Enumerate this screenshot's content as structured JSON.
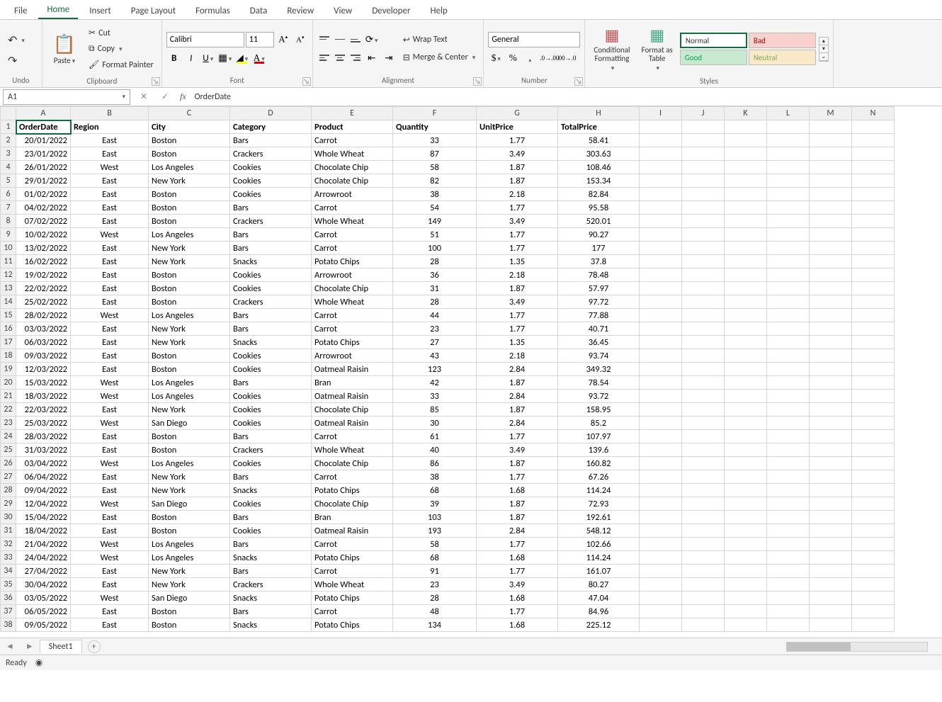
{
  "tabs": [
    "File",
    "Home",
    "Insert",
    "Page Layout",
    "Formulas",
    "Data",
    "Review",
    "View",
    "Developer",
    "Help"
  ],
  "active_tab": "Home",
  "ribbon": {
    "undo_label": "Undo",
    "clipboard_label": "Clipboard",
    "paste": "Paste",
    "cut": "Cut",
    "copy": "Copy",
    "format_painter": "Format Painter",
    "font_label": "Font",
    "font_name": "Calibri",
    "font_size": "11",
    "alignment_label": "Alignment",
    "wrap_text": "Wrap Text",
    "merge_center": "Merge & Center",
    "number_label": "Number",
    "number_format": "General",
    "cond_fmt": "Conditional\nFormatting",
    "fmt_table": "Format as\nTable",
    "styles_label": "Styles",
    "style_normal": "Normal",
    "style_bad": "Bad",
    "style_good": "Good",
    "style_neutral": "Neutral"
  },
  "namebox": "A1",
  "formula": "OrderDate",
  "columns": [
    "A",
    "B",
    "C",
    "D",
    "E",
    "F",
    "G",
    "H",
    "I",
    "J",
    "K",
    "L",
    "M",
    "N"
  ],
  "col_widths": [
    "col-A",
    "col-B",
    "col-C",
    "col-C",
    "col-C",
    "col-F",
    "col-G",
    "col-H",
    "col-rest",
    "col-rest",
    "col-rest",
    "col-rest",
    "col-rest",
    "col-rest"
  ],
  "headers": [
    "OrderDate",
    "Region",
    "City",
    "Category",
    "Product",
    "Quantity",
    "UnitPrice",
    "TotalPrice"
  ],
  "rows": [
    [
      "20/01/2022",
      "East",
      "Boston",
      "Bars",
      "Carrot",
      "33",
      "1.77",
      "58.41"
    ],
    [
      "23/01/2022",
      "East",
      "Boston",
      "Crackers",
      "Whole Wheat",
      "87",
      "3.49",
      "303.63"
    ],
    [
      "26/01/2022",
      "West",
      "Los Angeles",
      "Cookies",
      "Chocolate Chip",
      "58",
      "1.87",
      "108.46"
    ],
    [
      "29/01/2022",
      "East",
      "New York",
      "Cookies",
      "Chocolate Chip",
      "82",
      "1.87",
      "153.34"
    ],
    [
      "01/02/2022",
      "East",
      "Boston",
      "Cookies",
      "Arrowroot",
      "38",
      "2.18",
      "82.84"
    ],
    [
      "04/02/2022",
      "East",
      "Boston",
      "Bars",
      "Carrot",
      "54",
      "1.77",
      "95.58"
    ],
    [
      "07/02/2022",
      "East",
      "Boston",
      "Crackers",
      "Whole Wheat",
      "149",
      "3.49",
      "520.01"
    ],
    [
      "10/02/2022",
      "West",
      "Los Angeles",
      "Bars",
      "Carrot",
      "51",
      "1.77",
      "90.27"
    ],
    [
      "13/02/2022",
      "East",
      "New York",
      "Bars",
      "Carrot",
      "100",
      "1.77",
      "177"
    ],
    [
      "16/02/2022",
      "East",
      "New York",
      "Snacks",
      "Potato Chips",
      "28",
      "1.35",
      "37.8"
    ],
    [
      "19/02/2022",
      "East",
      "Boston",
      "Cookies",
      "Arrowroot",
      "36",
      "2.18",
      "78.48"
    ],
    [
      "22/02/2022",
      "East",
      "Boston",
      "Cookies",
      "Chocolate Chip",
      "31",
      "1.87",
      "57.97"
    ],
    [
      "25/02/2022",
      "East",
      "Boston",
      "Crackers",
      "Whole Wheat",
      "28",
      "3.49",
      "97.72"
    ],
    [
      "28/02/2022",
      "West",
      "Los Angeles",
      "Bars",
      "Carrot",
      "44",
      "1.77",
      "77.88"
    ],
    [
      "03/03/2022",
      "East",
      "New York",
      "Bars",
      "Carrot",
      "23",
      "1.77",
      "40.71"
    ],
    [
      "06/03/2022",
      "East",
      "New York",
      "Snacks",
      "Potato Chips",
      "27",
      "1.35",
      "36.45"
    ],
    [
      "09/03/2022",
      "East",
      "Boston",
      "Cookies",
      "Arrowroot",
      "43",
      "2.18",
      "93.74"
    ],
    [
      "12/03/2022",
      "East",
      "Boston",
      "Cookies",
      "Oatmeal Raisin",
      "123",
      "2.84",
      "349.32"
    ],
    [
      "15/03/2022",
      "West",
      "Los Angeles",
      "Bars",
      "Bran",
      "42",
      "1.87",
      "78.54"
    ],
    [
      "18/03/2022",
      "West",
      "Los Angeles",
      "Cookies",
      "Oatmeal Raisin",
      "33",
      "2.84",
      "93.72"
    ],
    [
      "22/03/2022",
      "East",
      "New York",
      "Cookies",
      "Chocolate Chip",
      "85",
      "1.87",
      "158.95"
    ],
    [
      "25/03/2022",
      "West",
      "San Diego",
      "Cookies",
      "Oatmeal Raisin",
      "30",
      "2.84",
      "85.2"
    ],
    [
      "28/03/2022",
      "East",
      "Boston",
      "Bars",
      "Carrot",
      "61",
      "1.77",
      "107.97"
    ],
    [
      "31/03/2022",
      "East",
      "Boston",
      "Crackers",
      "Whole Wheat",
      "40",
      "3.49",
      "139.6"
    ],
    [
      "03/04/2022",
      "West",
      "Los Angeles",
      "Cookies",
      "Chocolate Chip",
      "86",
      "1.87",
      "160.82"
    ],
    [
      "06/04/2022",
      "East",
      "New York",
      "Bars",
      "Carrot",
      "38",
      "1.77",
      "67.26"
    ],
    [
      "09/04/2022",
      "East",
      "New York",
      "Snacks",
      "Potato Chips",
      "68",
      "1.68",
      "114.24"
    ],
    [
      "12/04/2022",
      "West",
      "San Diego",
      "Cookies",
      "Chocolate Chip",
      "39",
      "1.87",
      "72.93"
    ],
    [
      "15/04/2022",
      "East",
      "Boston",
      "Bars",
      "Bran",
      "103",
      "1.87",
      "192.61"
    ],
    [
      "18/04/2022",
      "East",
      "Boston",
      "Cookies",
      "Oatmeal Raisin",
      "193",
      "2.84",
      "548.12"
    ],
    [
      "21/04/2022",
      "West",
      "Los Angeles",
      "Bars",
      "Carrot",
      "58",
      "1.77",
      "102.66"
    ],
    [
      "24/04/2022",
      "West",
      "Los Angeles",
      "Snacks",
      "Potato Chips",
      "68",
      "1.68",
      "114.24"
    ],
    [
      "27/04/2022",
      "East",
      "New York",
      "Bars",
      "Carrot",
      "91",
      "1.77",
      "161.07"
    ],
    [
      "30/04/2022",
      "East",
      "New York",
      "Crackers",
      "Whole Wheat",
      "23",
      "3.49",
      "80.27"
    ],
    [
      "03/05/2022",
      "West",
      "San Diego",
      "Snacks",
      "Potato Chips",
      "28",
      "1.68",
      "47.04"
    ],
    [
      "06/05/2022",
      "East",
      "Boston",
      "Bars",
      "Carrot",
      "48",
      "1.77",
      "84.96"
    ],
    [
      "09/05/2022",
      "East",
      "Boston",
      "Snacks",
      "Potato Chips",
      "134",
      "1.68",
      "225.12"
    ]
  ],
  "sheet_tab": "Sheet1",
  "status": "Ready"
}
